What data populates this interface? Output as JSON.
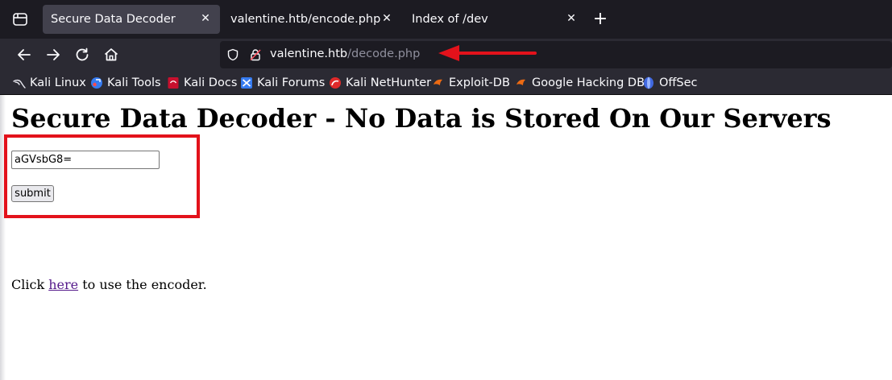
{
  "tabs": [
    {
      "title": "Secure Data Decoder",
      "active": true
    },
    {
      "title": "valentine.htb/encode.php",
      "active": false
    },
    {
      "title": "Index of /dev",
      "active": false
    }
  ],
  "close_glyph": "✕",
  "newtab_glyph": "+",
  "url": {
    "host": "valentine.htb",
    "path": "/decode.php"
  },
  "bookmarks": [
    {
      "label": "Kali Linux",
      "icon": "kali-dragon-icon"
    },
    {
      "label": "Kali Tools",
      "icon": "kali-tools-icon"
    },
    {
      "label": "Kali Docs",
      "icon": "kali-docs-icon"
    },
    {
      "label": "Kali Forums",
      "icon": "kali-forums-icon"
    },
    {
      "label": "Kali NetHunter",
      "icon": "nethunter-icon"
    },
    {
      "label": "Exploit-DB",
      "icon": "exploit-db-icon"
    },
    {
      "label": "Google Hacking DB",
      "icon": "ghdb-icon"
    },
    {
      "label": "OffSec",
      "icon": "offsec-icon"
    }
  ],
  "page": {
    "heading": "Secure Data Decoder - No Data is Stored On Our Servers",
    "input_value": "aGVsbG8=",
    "submit_label": "submit",
    "footer_before": "Click ",
    "footer_link": "here",
    "footer_after": " to use the encoder."
  },
  "colors": {
    "annotation_red": "#e3121b",
    "tab_bg": "#1c1b22",
    "toolbar_bg": "#2b2a33",
    "active_tab": "#42414d",
    "link_visited": "#551a8b"
  }
}
